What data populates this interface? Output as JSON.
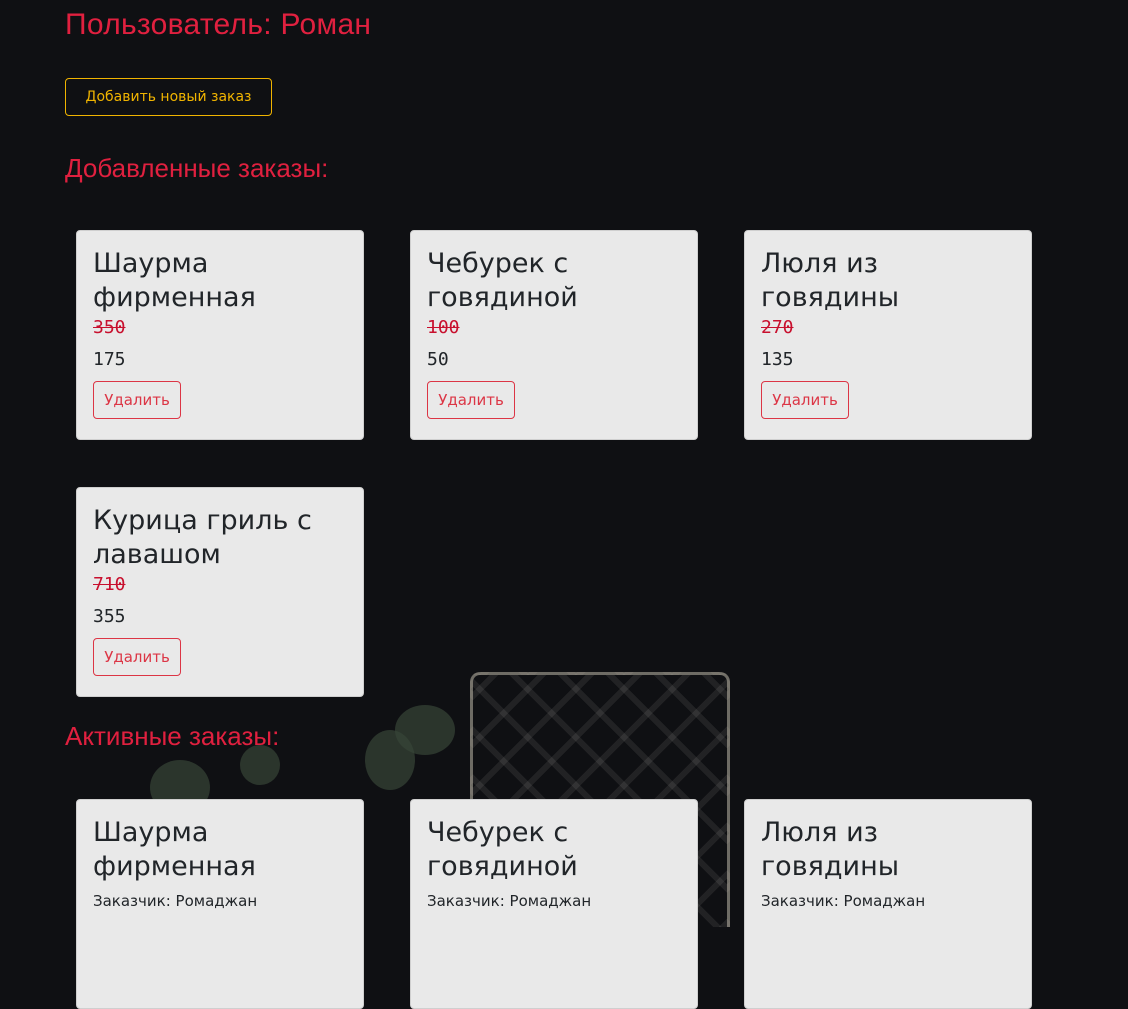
{
  "user_title": "Пользователь: Роман",
  "add_order_button": "Добавить новый заказ",
  "added_section": {
    "title": "Добавленные заказы:",
    "items": [
      {
        "name": "Шаурма фирменная",
        "old_price": "350",
        "new_price": "175",
        "delete_label": "Удалить"
      },
      {
        "name": "Чебурек с говядиной",
        "old_price": "100",
        "new_price": "50",
        "delete_label": "Удалить"
      },
      {
        "name": "Люля из говядины",
        "old_price": "270",
        "new_price": "135",
        "delete_label": "Удалить"
      },
      {
        "name": "Курица гриль с лавашом",
        "old_price": "710",
        "new_price": "355",
        "delete_label": "Удалить"
      }
    ]
  },
  "active_section": {
    "title": "Активные заказы:",
    "items": [
      {
        "name": "Шаурма фирменная",
        "customer": "Заказчик: Ромаджан"
      },
      {
        "name": "Чебурек с говядиной",
        "customer": "Заказчик: Ромаджан"
      },
      {
        "name": "Люля из говядины",
        "customer": "Заказчик: Ромаджан"
      }
    ]
  },
  "colors": {
    "accent_red": "#e0203f",
    "button_yellow": "#f0b400",
    "card_bg": "#e9e9e9",
    "delete_red": "#dc3545"
  }
}
